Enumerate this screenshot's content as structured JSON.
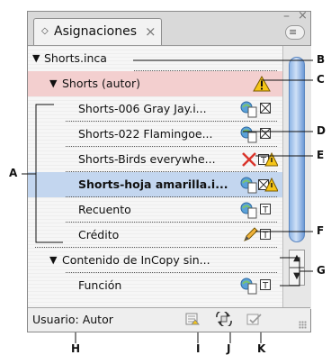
{
  "panel": {
    "tab_title": "Asignaciones",
    "tab_close": "×",
    "menu_icon": "≡"
  },
  "rows": [
    {
      "label": "Shorts.inca"
    },
    {
      "label": "Shorts (autor)"
    },
    {
      "label": "Shorts-006 Gray Jay.i..."
    },
    {
      "label": "Shorts-022 Flamingoe..."
    },
    {
      "label": "Shorts-Birds everywhe..."
    },
    {
      "label_bold": "Shorts-",
      "label_rest": "hoja amarilla.i..."
    },
    {
      "label": "Recuento"
    },
    {
      "label": "Crédito"
    },
    {
      "label": "Contenido de InCopy sin..."
    },
    {
      "label": "Función"
    }
  ],
  "status": {
    "user": "Usuario: Autor"
  },
  "callouts": {
    "A": "A",
    "B": "B",
    "C": "C",
    "D": "D",
    "E": "E",
    "F": "F",
    "G": "G",
    "H": "H",
    "I": "I",
    "J": "J",
    "K": "K"
  },
  "colors": {
    "selected_row": "#c3d6ef",
    "author_row": "#f3cfcf",
    "scroll_thumb": "#8fb6e6"
  }
}
